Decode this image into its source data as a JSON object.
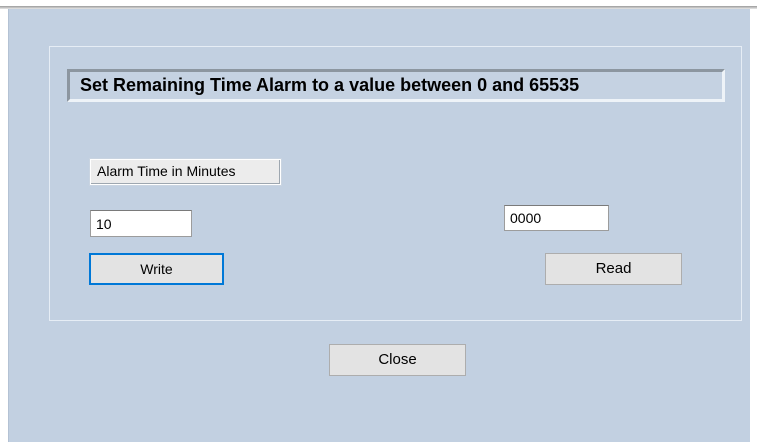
{
  "dialog": {
    "title_text": "Set Remaining Time Alarm to a value between 0 and  65535",
    "alarm_label": "Alarm Time in Minutes",
    "alarm_input_value": "10",
    "read_value": "0000",
    "write_label": "Write",
    "read_label": "Read",
    "close_label": "Close"
  },
  "colors": {
    "dialog_background": "#c2d0e1",
    "button_background": "#e3e3e3",
    "focus_border": "#0078d7"
  }
}
